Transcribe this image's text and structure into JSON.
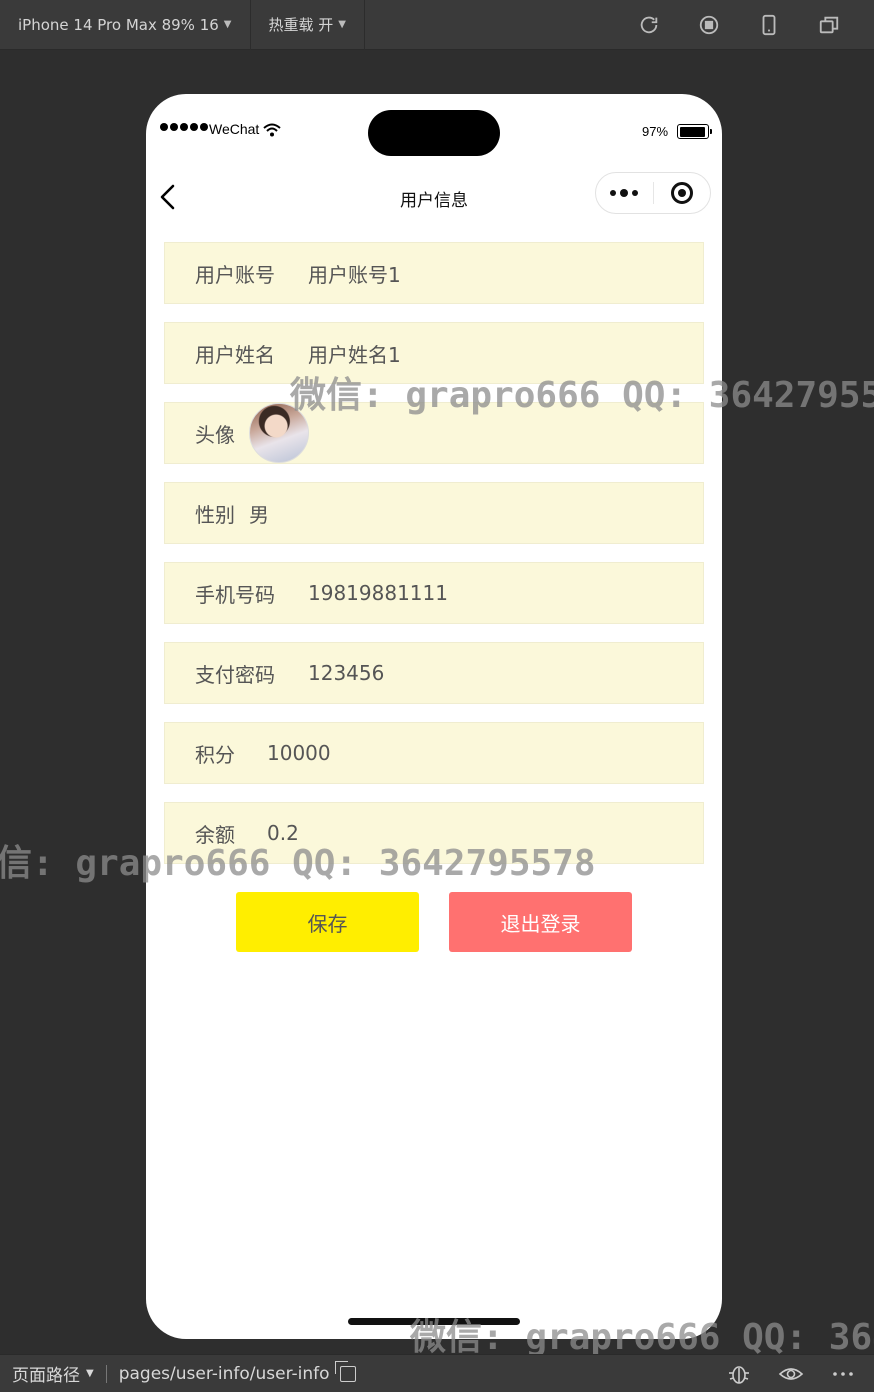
{
  "devtools": {
    "device_label": "iPhone 14 Pro Max 89% 16",
    "hot_reload_label": "热重载 开",
    "icons": [
      "refresh-icon",
      "stop-icon",
      "phone-icon",
      "window-icon"
    ]
  },
  "statusbar": {
    "carrier": "WeChat",
    "battery": "97%",
    "battery_level": 0.97
  },
  "navbar": {
    "title": "用户信息"
  },
  "form": {
    "account": {
      "label": "用户账号",
      "value": "用户账号1"
    },
    "name": {
      "label": "用户姓名",
      "value": "用户姓名1"
    },
    "avatar": {
      "label": "头像"
    },
    "gender": {
      "label": "性别",
      "value": "男"
    },
    "phone": {
      "label": "手机号码",
      "value": "19819881111"
    },
    "pay_password": {
      "label": "支付密码",
      "value": "123456"
    },
    "points": {
      "label": "积分",
      "value": "10000"
    },
    "balance": {
      "label": "余额",
      "value": "0.2"
    }
  },
  "actions": {
    "save": "保存",
    "logout": "退出登录"
  },
  "watermark": "微信: grapro666 QQ: 3642795578",
  "bottombar": {
    "path_label": "页面路径",
    "path": "pages/user-info/user-info"
  },
  "colors": {
    "row_bg": "#fbf8da",
    "save_bg": "#ffee00",
    "logout_bg": "#ff7170"
  }
}
